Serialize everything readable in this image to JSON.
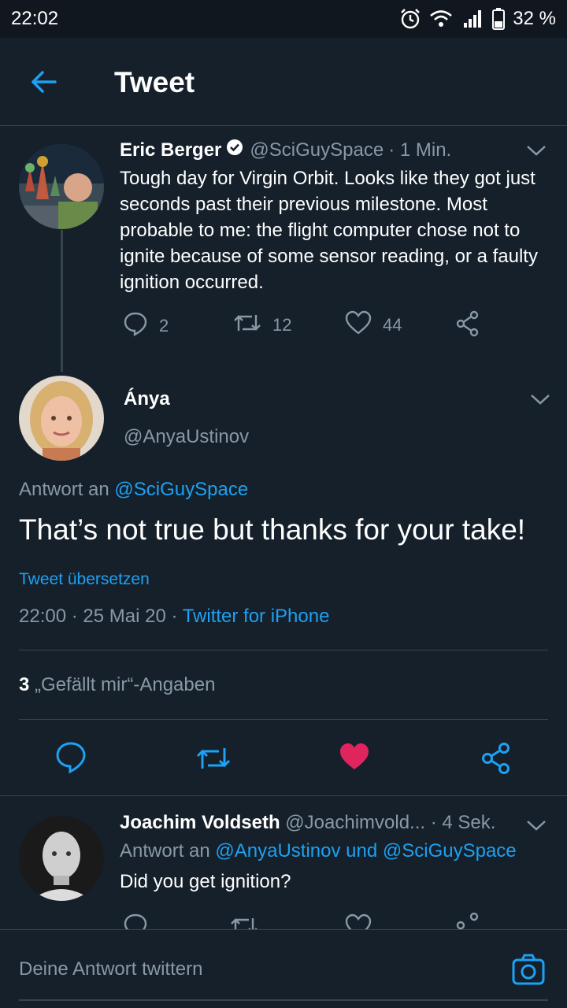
{
  "status_bar": {
    "time": "22:02",
    "battery": "32 %"
  },
  "app_bar": {
    "title": "Tweet"
  },
  "parent_tweet": {
    "name": "Eric Berger",
    "handle": "@SciGuySpace",
    "time": "· 1 Min.",
    "text": "Tough day for Virgin Orbit. Looks like they got just seconds past their previous milestone. Most probable to me: the flight computer chose not to ignite because of some sensor reading, or a faulty ignition occurred.",
    "reply_count": "2",
    "retweet_count": "12",
    "like_count": "44"
  },
  "main_tweet": {
    "name": "Ánya",
    "handle": "@AnyaUstinov",
    "reply_prefix": "Antwort an",
    "reply_to": "@SciGuySpace",
    "text": "That’s not true but thanks for your take!",
    "translate": "Tweet übersetzen",
    "timestamp": "22:00 · 25 Mai 20 ·",
    "source": "Twitter for iPhone",
    "likes_count": "3",
    "likes_label": "„Gefällt mir“-Angaben"
  },
  "reply_tweet": {
    "name": "Joachim Voldseth",
    "handle": "@Joachimvold...",
    "time": "· 4 Sek.",
    "reply_prefix": "Antwort an",
    "reply_to": "@AnyaUstinov und @SciGuySpace",
    "text": "Did you get ignition?"
  },
  "composer": {
    "placeholder": "Deine Antwort twittern"
  },
  "colors": {
    "background": "#15202b",
    "accent": "#1da1f2",
    "secondary_text": "#8899a6",
    "like": "#e0245e",
    "divider": "#38444d"
  }
}
